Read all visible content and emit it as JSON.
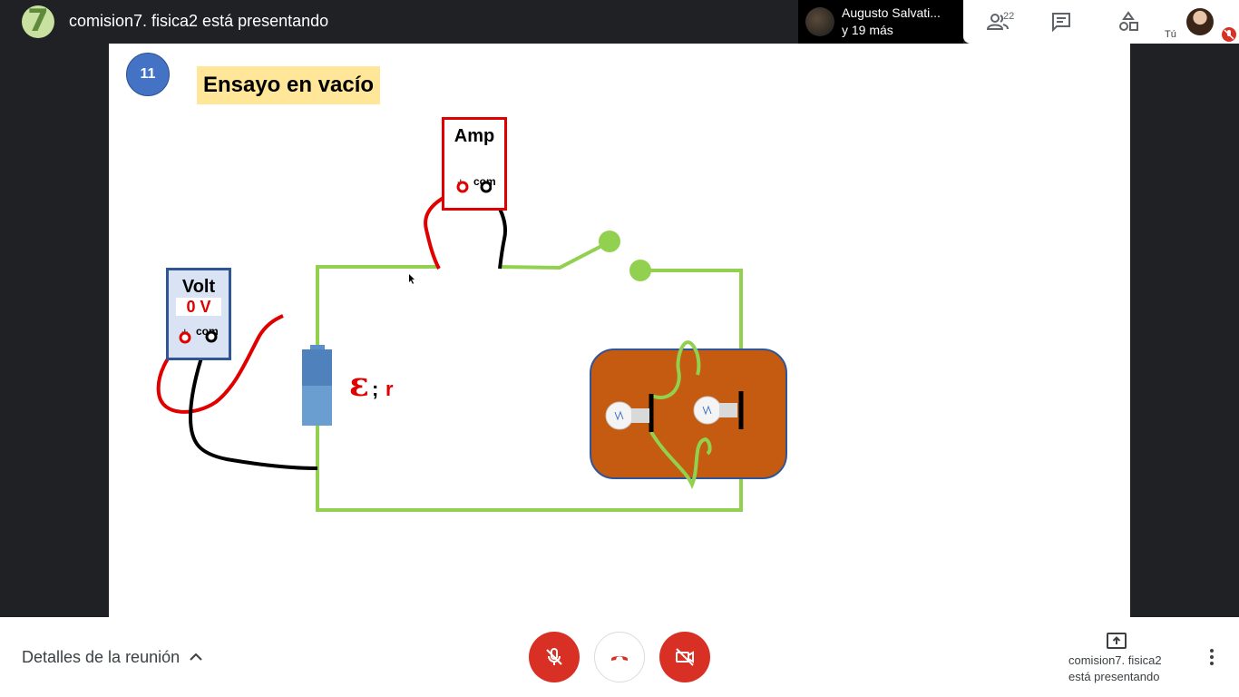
{
  "header": {
    "presenter_title": "comision7. fisica2 está presentando",
    "participants_name": "Augusto Salvati...",
    "participants_more": "y 19 más",
    "people_count": "22",
    "self_label": "Tú",
    "icons": [
      "people-icon",
      "chat-icon",
      "activities-icon"
    ]
  },
  "slide": {
    "number": "11",
    "title": "Ensayo en vacío",
    "ammeter": {
      "label": "Amp",
      "plus": "+",
      "com": "com"
    },
    "voltmeter": {
      "label": "Volt",
      "reading": "0 V",
      "plus": "+",
      "com": "com"
    },
    "emf_symbol": "ε",
    "emf_separator": ";",
    "emf_r": "r",
    "colors": {
      "wire": "#92d050",
      "red_lead": "#e00000",
      "black_lead": "#000000",
      "lamp_board": "#c55a11",
      "title_bg": "#ffe699",
      "number_bg": "#4472c4"
    }
  },
  "footer": {
    "meeting_details": "Detalles de la reunión",
    "presenting_line1": "comision7. fisica2",
    "presenting_line2": "está presentando",
    "mic_state": "muted",
    "camera_state": "off"
  }
}
